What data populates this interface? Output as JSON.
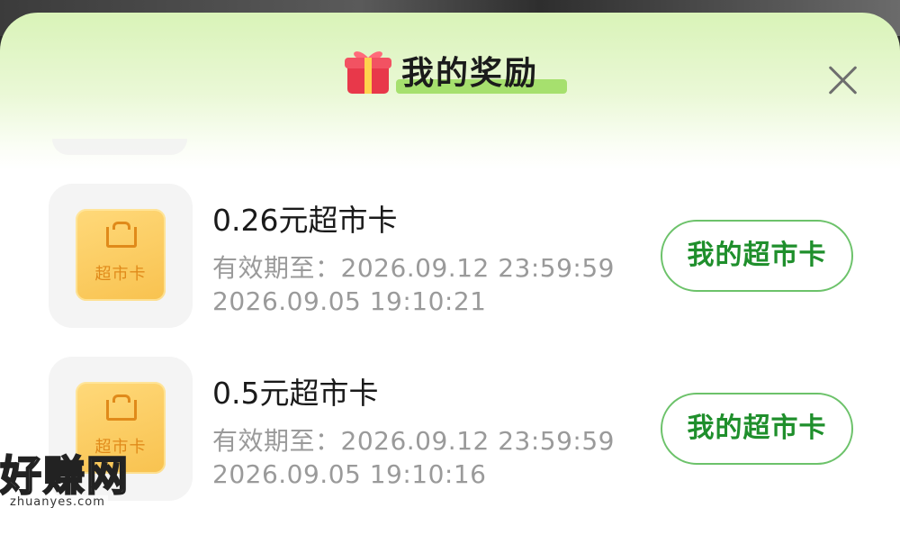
{
  "header": {
    "title": "我的奖励"
  },
  "rewards": [
    {
      "title": "0.26元超市卡",
      "expiry": "有效期至：2026.09.12 23:59:59",
      "date": "2026.09.05 19:10:21",
      "icon_label": "超市卡",
      "button_label": "我的超市卡"
    },
    {
      "title": "0.5元超市卡",
      "expiry": "有效期至：2026.09.12 23:59:59",
      "date": "2026.09.05 19:10:16",
      "icon_label": "超市卡",
      "button_label": "我的超市卡"
    }
  ],
  "watermark": {
    "text": "好赚网",
    "url": "zhuanyes.com"
  },
  "icons": {
    "header": "gift-icon",
    "close": "close-icon",
    "reward": "shopping-card-icon"
  },
  "colors": {
    "accent_green": "#1f8f2c",
    "button_border": "#6cc26a",
    "card_yellow": "#f8c24f",
    "card_orange": "#e08a1a"
  }
}
